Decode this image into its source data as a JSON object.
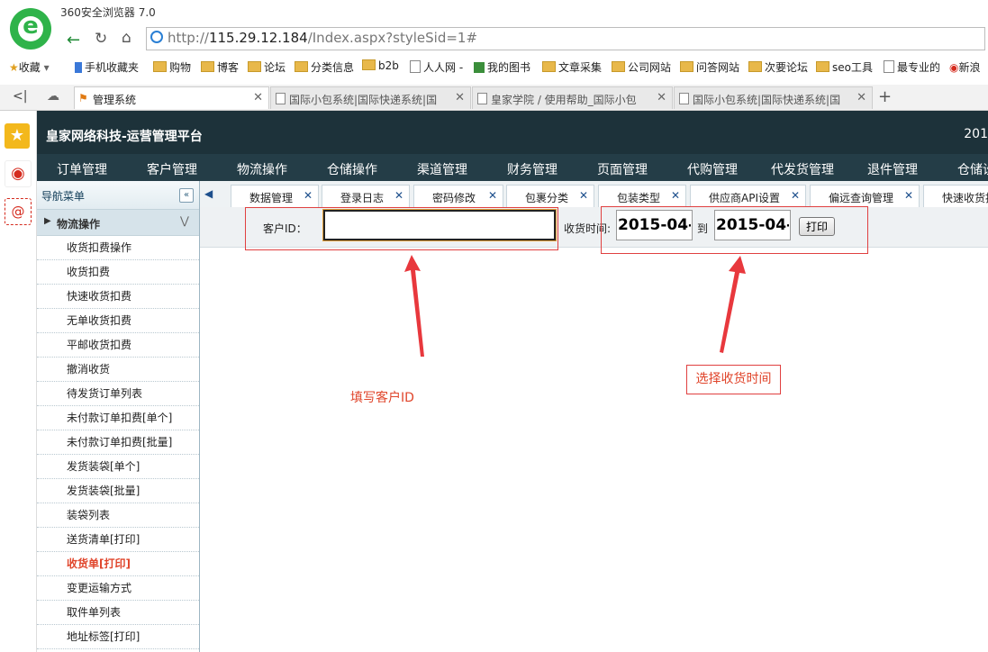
{
  "browser": {
    "title": "360安全浏览器 7.0",
    "address_prefix": "http://",
    "address_host": "115.29.12.184",
    "address_path": "/Index.aspx?styleSid=1#",
    "bookmarks": [
      "收藏",
      "手机收藏夹",
      "购物",
      "博客",
      "论坛",
      "分类信息",
      "b2b",
      "人人网 -",
      "我的图书",
      "文章采集",
      "公司网站",
      "问答网站",
      "次要论坛",
      "seo工具",
      "最专业的",
      "新浪"
    ],
    "tabs": [
      {
        "label": "管理系统",
        "active": true
      },
      {
        "label": "国际小包系统|国际快递系统|国",
        "active": false
      },
      {
        "label": "皇家学院 / 使用帮助_国际小包",
        "active": false
      },
      {
        "label": "国际小包系统|国际快递系统|国",
        "active": false
      }
    ]
  },
  "app": {
    "title": "皇家网络科技-运营管理平台",
    "year": "201",
    "main_nav": [
      "订单管理",
      "客户管理",
      "物流操作",
      "仓储操作",
      "渠道管理",
      "财务管理",
      "页面管理",
      "代购管理",
      "代发货管理",
      "退件管理",
      "仓储设"
    ]
  },
  "sidebar": {
    "title": "导航菜单",
    "section": "物流操作",
    "items": [
      "收货扣费操作",
      "收货扣费",
      "快速收货扣费",
      "无单收货扣费",
      "平邮收货扣费",
      "撤消收货",
      "待发货订单列表",
      "未付款订单扣费[单个]",
      "未付款订单扣费[批量]",
      "发货装袋[单个]",
      "发货装袋[批量]",
      "装袋列表",
      "送货清单[打印]",
      "收货单[打印]",
      "变更运输方式",
      "取件单列表",
      "地址标签[打印]"
    ],
    "active_item": "收货单[打印]"
  },
  "content_tabs": [
    "数据管理",
    "登录日志",
    "密码修改",
    "包裹分类",
    "包装类型",
    "供应商API设置",
    "偏远查询管理",
    "快速收货扣"
  ],
  "form": {
    "customer_id_label": "客户ID：",
    "customer_id_value": "",
    "time_label": "收货时间:",
    "date_from": "2015-04-",
    "to_label": "到",
    "date_to": "2015-04-",
    "print_button": "打印"
  },
  "annotations": {
    "fill_customer": "填写客户ID",
    "select_time": "选择收货时间",
    "color": "#e0452b"
  }
}
